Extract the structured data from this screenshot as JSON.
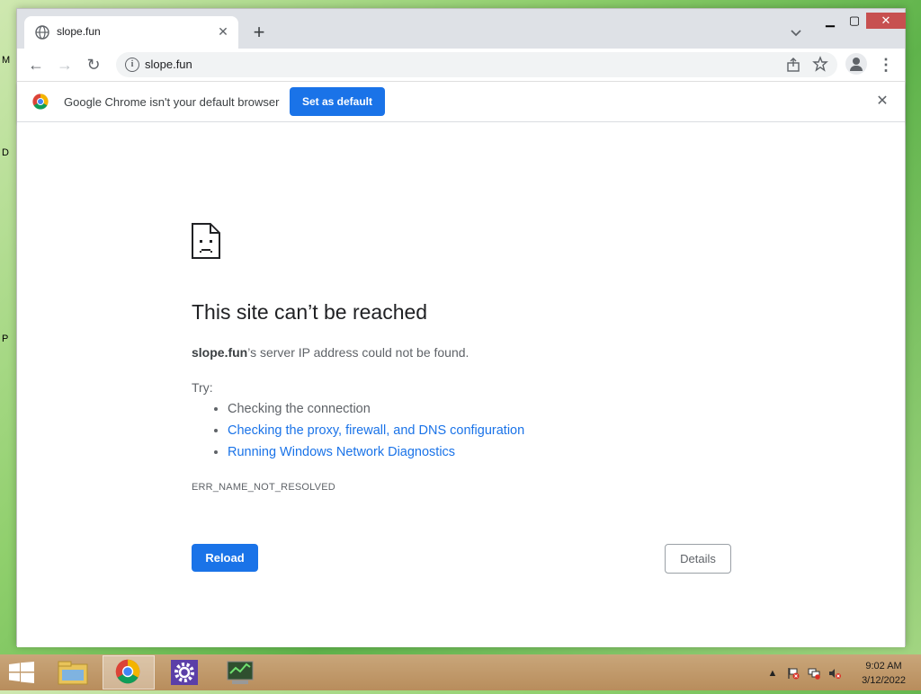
{
  "desktop": {
    "edge_letters": [
      "M",
      "D",
      "P"
    ]
  },
  "browser": {
    "tab": {
      "title": "slope.fun",
      "close_symbol": "✕"
    },
    "new_tab_symbol": "+",
    "window_controls": {
      "minimize": "▁",
      "maximize": "▢",
      "close": "✕"
    },
    "toolbar": {
      "back": "←",
      "forward": "→",
      "reload": "↻",
      "address": "slope.fun",
      "menu": "⋮"
    },
    "infobar": {
      "message": "Google Chrome isn't your default browser",
      "button": "Set as default",
      "close": "✕"
    },
    "error_page": {
      "heading": "This site can’t be reached",
      "domain": "slope.fun",
      "message_rest": "’s server IP address could not be found.",
      "try_label": "Try:",
      "suggestions": [
        "Checking the connection",
        "Checking the proxy, firewall, and DNS configuration",
        "Running Windows Network Diagnostics"
      ],
      "error_code": "ERR_NAME_NOT_RESOLVED",
      "reload_label": "Reload",
      "details_label": "Details"
    }
  },
  "taskbar": {
    "apps": [
      "file-explorer",
      "chrome",
      "settings",
      "network-monitor"
    ],
    "active_app": "chrome",
    "clock": {
      "time": "9:02 AM",
      "date": "3/12/2022"
    }
  },
  "colors": {
    "accent": "#1a73e8",
    "link": "#1a73e8"
  }
}
